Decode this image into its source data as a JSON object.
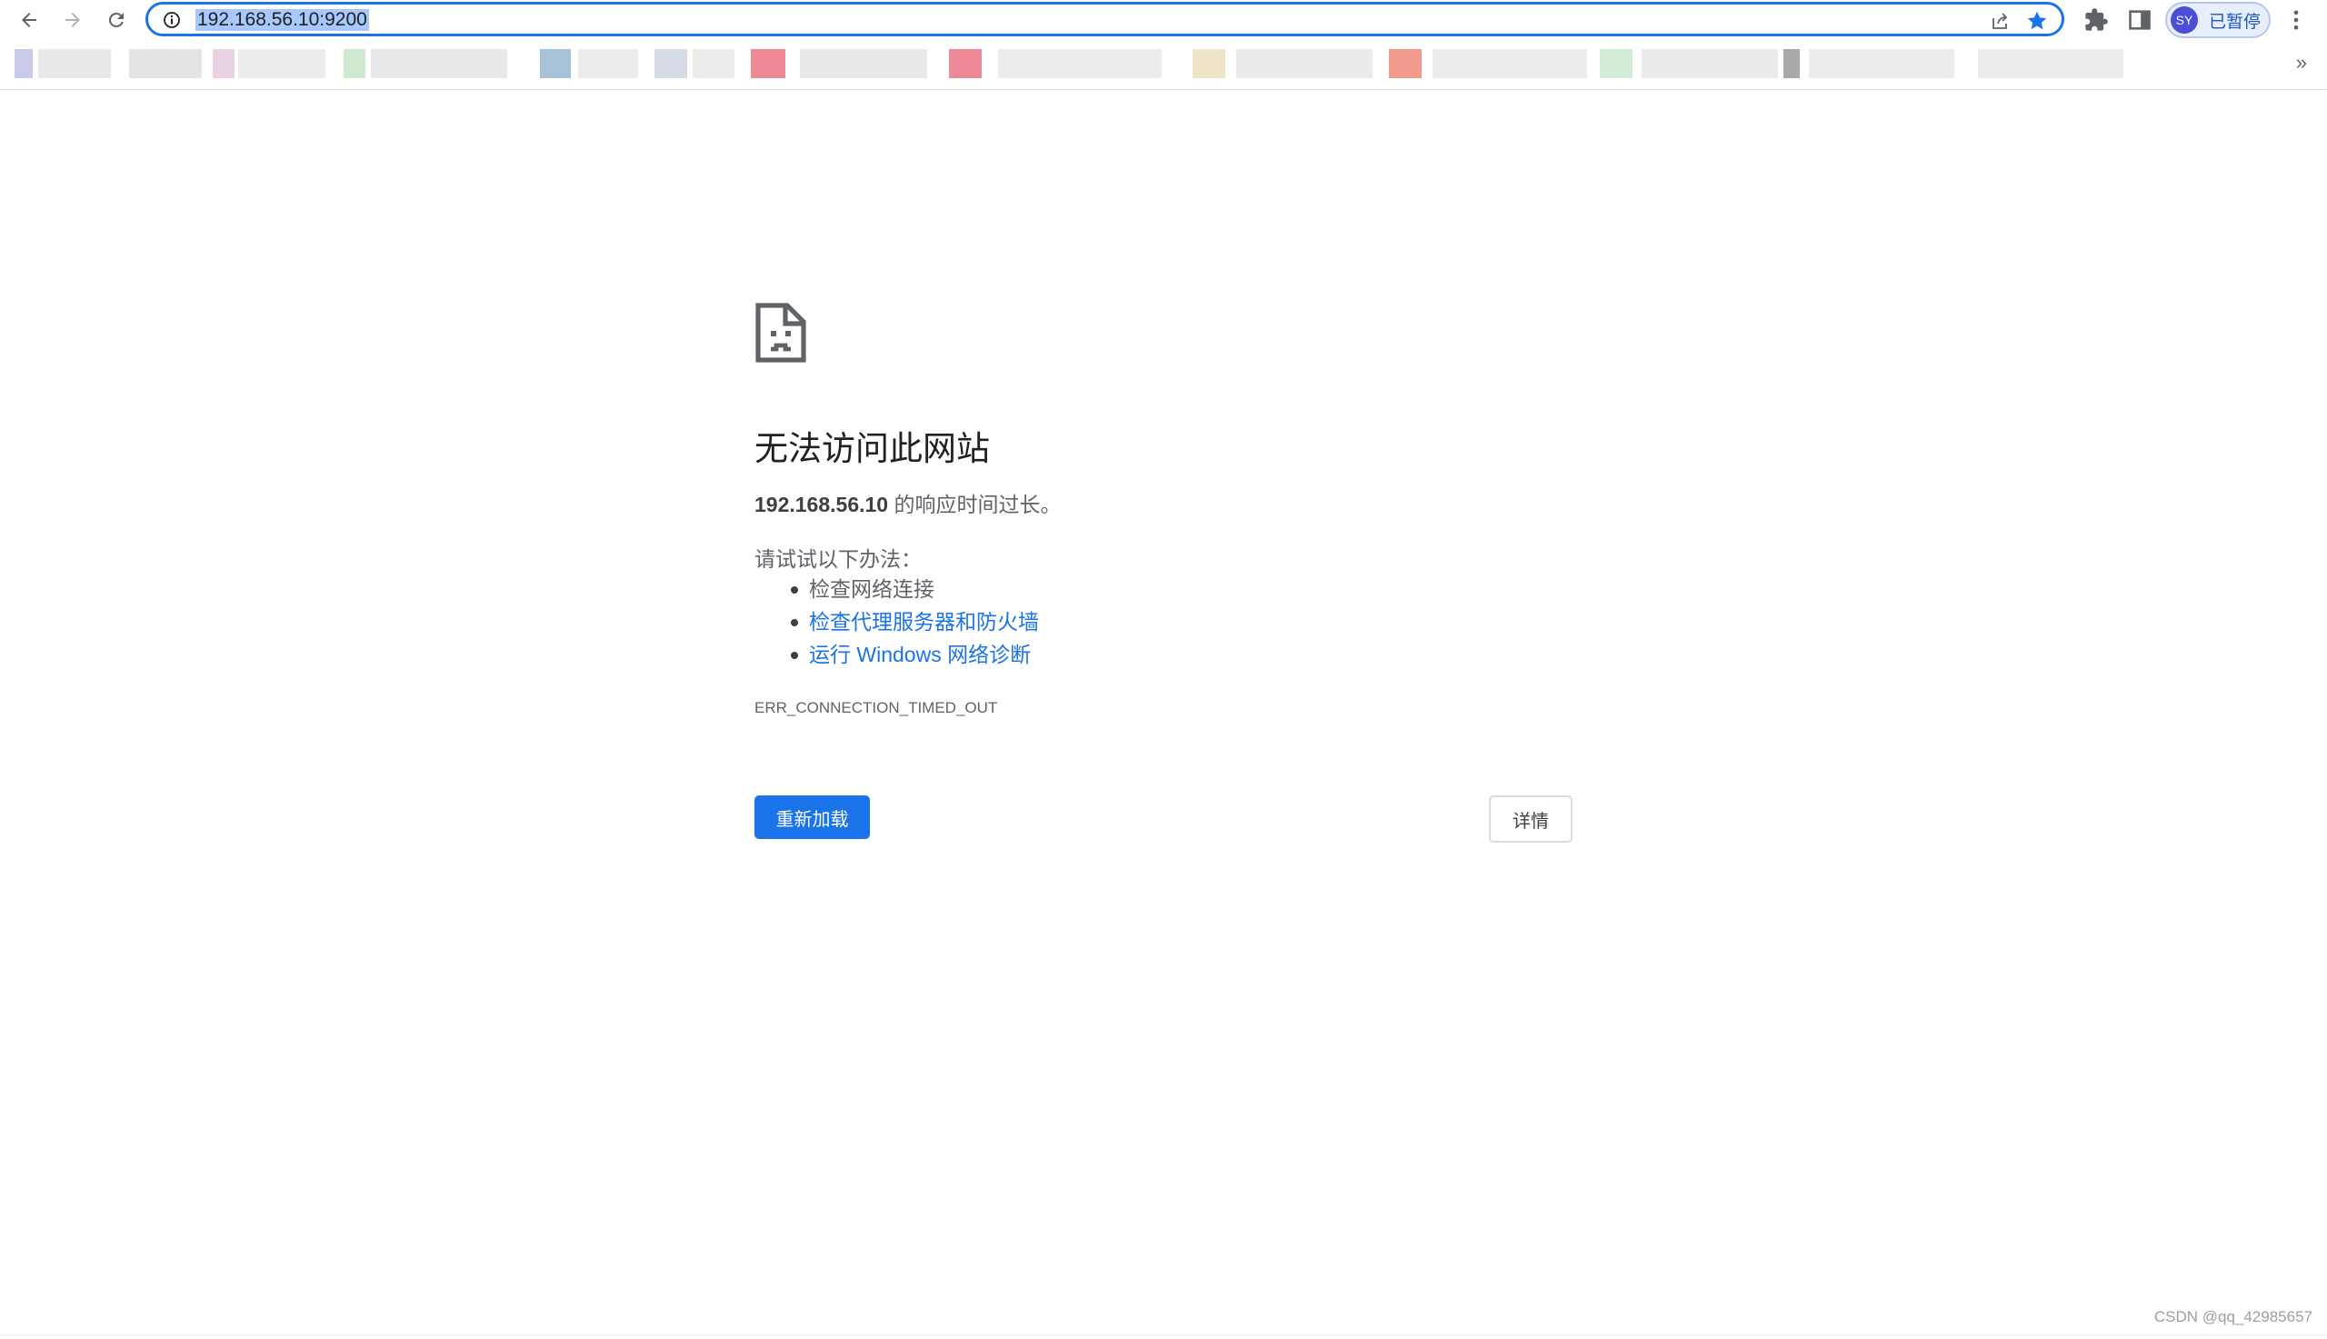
{
  "browser": {
    "url": "192.168.56.10:9200",
    "profile": {
      "initials": "SY",
      "status": "已暂停"
    },
    "bookmarks_more": "»",
    "accent_color": "#1a73e8"
  },
  "error": {
    "heading": "无法访问此网站",
    "host": "192.168.56.10",
    "summary_suffix": " 的响应时间过长。",
    "suggestions_heading": "请试试以下办法：",
    "suggestions": [
      {
        "label": "检查网络连接"
      },
      {
        "label": "检查代理服务器和防火墙"
      },
      {
        "label": "运行 Windows 网络诊断"
      }
    ],
    "code": "ERR_CONNECTION_TIMED_OUT",
    "reload_label": "重新加载",
    "details_label": "详情"
  },
  "watermark": "CSDN @qq_42985657"
}
